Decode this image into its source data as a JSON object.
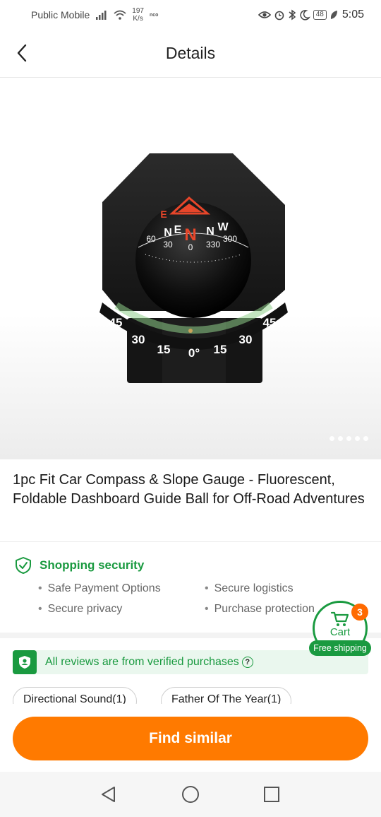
{
  "status_bar": {
    "carrier": "Public Mobile",
    "speed_value": "197",
    "speed_unit": "K/s",
    "tiny_label": "nco",
    "battery": "48",
    "time": "5:05"
  },
  "header": {
    "title": "Details",
    "back_icon": "chevron-left-icon"
  },
  "product_image": {
    "description_icon": "compass-photo",
    "dial_letters": [
      "E",
      "N",
      "E",
      "N",
      "N",
      "W"
    ],
    "dial_numbers": [
      "60",
      "30",
      "0",
      "330",
      "300"
    ],
    "slope_numbers": [
      "45",
      "30",
      "15",
      "0°",
      "15",
      "30",
      "45"
    ],
    "carousel_dots": 5
  },
  "product": {
    "title": "1pc Fit Car Compass & Slope Gauge - Fluorescent, Foldable Dashboard Guide Ball for Off-Road Adventures"
  },
  "security": {
    "title": "Shopping security",
    "items": [
      "Safe Payment Options",
      "Secure logistics",
      "Secure privacy",
      "Purchase protection"
    ]
  },
  "reviews": {
    "verified_text": "All reviews are from verified purchases",
    "help_icon": "?",
    "tags": [
      "Directional Sound(1)",
      "Father Of The Year(1)"
    ]
  },
  "cart": {
    "label": "Cart",
    "shipping": "Free shipping",
    "count": "3"
  },
  "actions": {
    "find_similar": "Find similar"
  },
  "colors": {
    "accent_orange": "#ff7a00",
    "brand_green": "#1a9a40",
    "badge_orange": "#ff6a00"
  }
}
